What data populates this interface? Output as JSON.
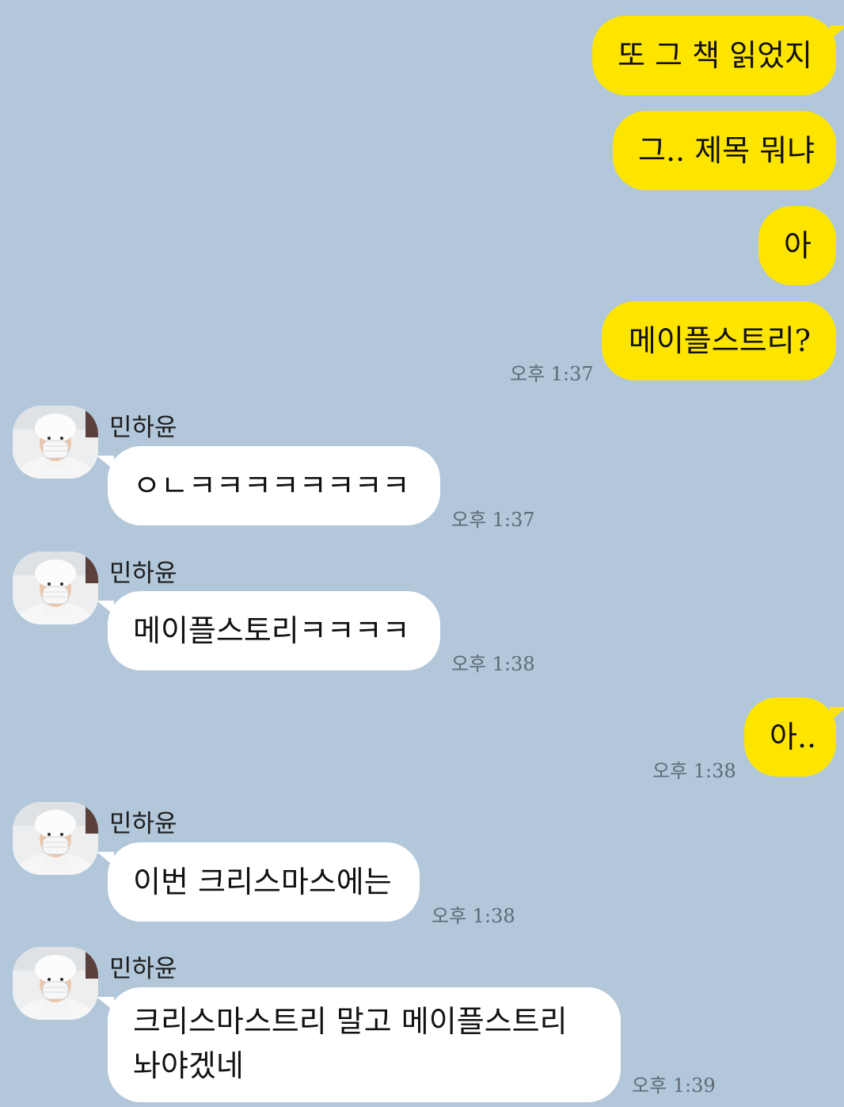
{
  "contact": {
    "name": "민하윤"
  },
  "messages": [
    {
      "from": "me",
      "text": "또 그 책 읽었지"
    },
    {
      "from": "me",
      "text": "그.. 제목 뭐냐"
    },
    {
      "from": "me",
      "text": "아"
    },
    {
      "from": "me",
      "text": "메이플스트리?",
      "time": "오후 1:37"
    },
    {
      "from": "them",
      "text": "ㅇㄴㅋㅋㅋㅋㅋㅋㅋㅋ",
      "time": "오후 1:37"
    },
    {
      "from": "them",
      "text": "메이플스토리ㅋㅋㅋㅋ",
      "time": "오후 1:38"
    },
    {
      "from": "me",
      "text": "아..",
      "time": "오후 1:38"
    },
    {
      "from": "them",
      "text": "이번 크리스마스에는",
      "time": "오후 1:38"
    },
    {
      "from": "them",
      "text": "크리스마스트리 말고 메이플스트리 놔야겠네",
      "time": "오후 1:39"
    }
  ],
  "colors": {
    "background": "#b2c7da",
    "outgoing_bubble": "#fee500",
    "incoming_bubble": "#ffffff"
  },
  "icons": {
    "avatar": "profile-photo-icon"
  }
}
